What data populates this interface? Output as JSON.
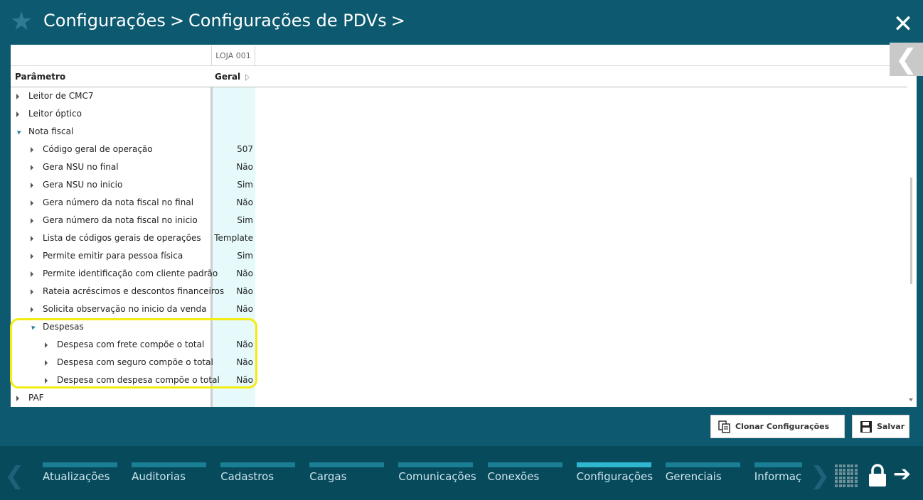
{
  "header": {
    "crumb1": "Configurações",
    "crumb2": "Configurações de PDVs",
    "sep": ">"
  },
  "table": {
    "store_header": "LOJA 001",
    "col_param": "Parâmetro",
    "col_geral": "Geral",
    "rows": [
      {
        "label": "Leitor de CMC7",
        "value": ""
      },
      {
        "label": "Leitor óptico",
        "value": ""
      },
      {
        "label": "Nota fiscal",
        "value": ""
      },
      {
        "label": "Código geral de operação",
        "value": "507"
      },
      {
        "label": "Gera NSU no final",
        "value": "Não"
      },
      {
        "label": "Gera NSU no inicio",
        "value": "Sim"
      },
      {
        "label": "Gera número da nota fiscal no final",
        "value": "Não"
      },
      {
        "label": "Gera número da nota fiscal no inicio",
        "value": "Sim"
      },
      {
        "label": "Lista de códigos gerais de operações",
        "value": "Template"
      },
      {
        "label": "Permite emitir para pessoa física",
        "value": "Sim"
      },
      {
        "label": "Permite identificação com cliente padrão",
        "value": "Não"
      },
      {
        "label": "Rateia acréscimos e descontos financeiros",
        "value": "Não"
      },
      {
        "label": "Solicita observação no inicio da venda",
        "value": "Não"
      },
      {
        "label": "Despesas",
        "value": ""
      },
      {
        "label": "Despesa com frete compõe o total",
        "value": "Não"
      },
      {
        "label": "Despesa com seguro compõe o total",
        "value": "Não"
      },
      {
        "label": "Despesa com despesa compõe o total",
        "value": "Não"
      },
      {
        "label": "PAF",
        "value": ""
      }
    ]
  },
  "buttons": {
    "clone": "Clonar Configurações",
    "save": "Salvar"
  },
  "nav": {
    "items": [
      "Atualizações",
      "Auditorias",
      "Cadastros",
      "Cargas",
      "Comunicações",
      "Conexões",
      "Configurações",
      "Gerenciais",
      "Informações"
    ],
    "active": "Configurações"
  },
  "colors": {
    "background": "#0d5a70",
    "footer": "#074a5c",
    "value_column": "#e6f9fb",
    "highlight": "#f2ec11",
    "nav_active_bar": "#2fb7d0"
  }
}
